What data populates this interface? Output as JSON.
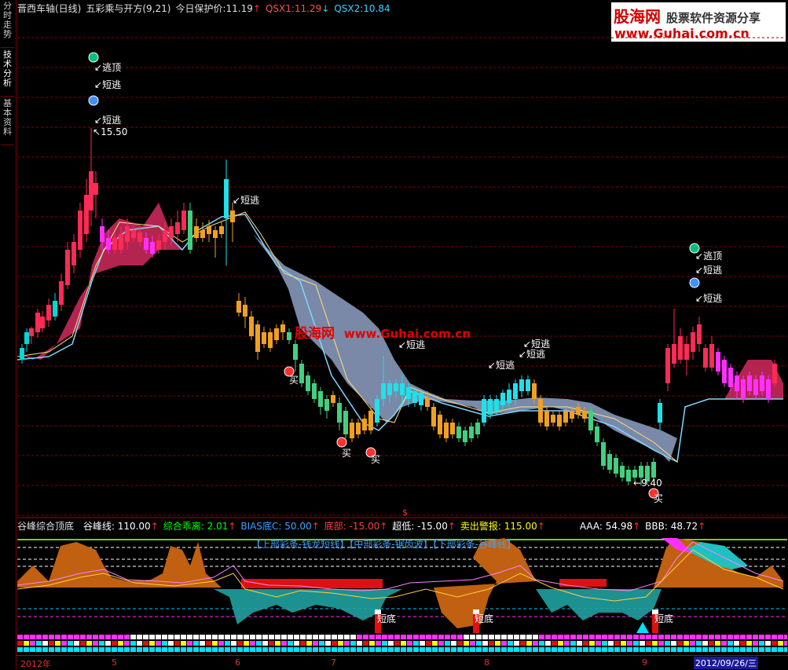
{
  "sidebar": {
    "tabs": [
      {
        "label": "分时走势",
        "active": false
      },
      {
        "label": "技术分析",
        "active": true
      },
      {
        "label": "基本资料",
        "active": false
      }
    ]
  },
  "header": {
    "stock": "晋西车轴(日线)",
    "indicator": "五彩乘与开方(9,21)",
    "protect_label": "今日保护价:",
    "protect_value": "11.19",
    "qsx1_label": "QSX1:",
    "qsx1_value": "11.29",
    "qsx2_label": "QSX2:",
    "qsx2_value": "10.84"
  },
  "logo": {
    "name": "股海网",
    "tagline": "股票软件资源分享",
    "url": "www.Guhai.com.cn"
  },
  "watermark": {
    "name": "股海网",
    "url": "www.Guhai.com.cn"
  },
  "main_annotations": {
    "top_escape": "逃顶",
    "short_escape": "短逃",
    "buy": "买",
    "high_price": "15.50",
    "low_price": "9.40",
    "dollar": "$"
  },
  "sub_header": {
    "name": "谷峰综合顶底",
    "items": [
      {
        "label": "谷峰线:",
        "value": "110.00",
        "color": "#ffffff"
      },
      {
        "label": "综合乖离:",
        "value": "2.01",
        "color": "#00ff00"
      },
      {
        "label": "BIAS底C:",
        "value": "50.00",
        "color": "#40a0ff"
      },
      {
        "label": "底部:",
        "value": "-15.00",
        "color": "#ff4040"
      },
      {
        "label": "超低:",
        "value": "-15.00",
        "color": "#ffffff"
      },
      {
        "label": "卖出警报:",
        "value": "115.00",
        "color": "#ffff00"
      },
      {
        "label": "AAA:",
        "value": "54.98",
        "color": "#ffffff"
      },
      {
        "label": "BBB:",
        "value": "48.72",
        "color": "#ffffff"
      }
    ]
  },
  "sub_legend": "【上部彩条-钱龙短线】【中部彩条-锯齿波】【下部彩条-谷峰线】",
  "sub_annotation": "短底",
  "xaxis": {
    "labels": [
      "2012年",
      "5",
      "6",
      "7",
      "8",
      "9"
    ],
    "cursor_date": "2012/09/26/三"
  },
  "colors": {
    "up": "#ff2a55",
    "down": "#00d8d8",
    "ribbon_bull": "#c8285a",
    "ribbon_bear": "#8090b0",
    "orange": "#f0a020",
    "grid": "#8a0000"
  }
}
